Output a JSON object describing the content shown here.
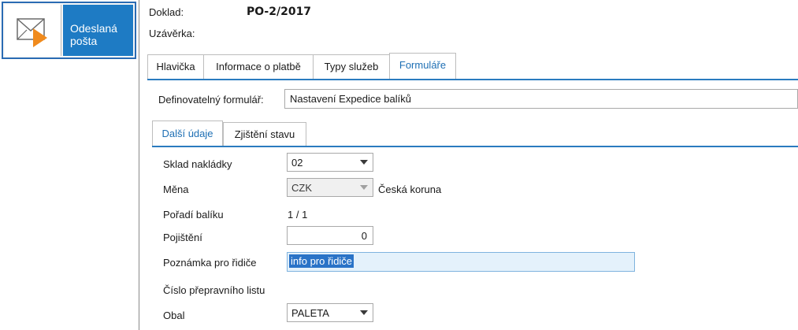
{
  "nav": {
    "icon": "mail-envelope-send-icon",
    "label_line1": "Odeslaná",
    "label_line2": "pošta"
  },
  "header": {
    "doc_label": "Doklad:",
    "doc_value": "PO-2/2017",
    "close_label": "Uzávěrka:"
  },
  "tabs": [
    {
      "label": "Hlavička",
      "active": false
    },
    {
      "label": "Informace o platbě",
      "active": false
    },
    {
      "label": "Typy služeb",
      "active": false
    },
    {
      "label": "Formuláře",
      "active": true
    }
  ],
  "form_def": {
    "label": "Definovatelný formulář:",
    "value": "Nastavení Expedice balíků"
  },
  "subtabs": [
    {
      "label": "Další údaje",
      "active": true
    },
    {
      "label": "Zjištění stavu",
      "active": false
    }
  ],
  "fields": {
    "sklad": {
      "label": "Sklad nakládky",
      "value": "02"
    },
    "mena": {
      "label": "Měna",
      "value": "CZK",
      "description": "Česká koruna"
    },
    "poradi": {
      "label": "Pořadí balíku",
      "value": "1 / 1"
    },
    "pojisteni": {
      "label": "Pojištění",
      "value": "0"
    },
    "poznamka": {
      "label": "Poznámka pro řidiče",
      "value": "info pro řidiče"
    },
    "cislo_listu": {
      "label": "Číslo přepravního listu"
    },
    "obal": {
      "label": "Obal",
      "value": "PALETA"
    }
  },
  "colors": {
    "accent": "#1e7bc4",
    "tab_active_text": "#1e6fb4",
    "selection": "#2a73c7"
  }
}
